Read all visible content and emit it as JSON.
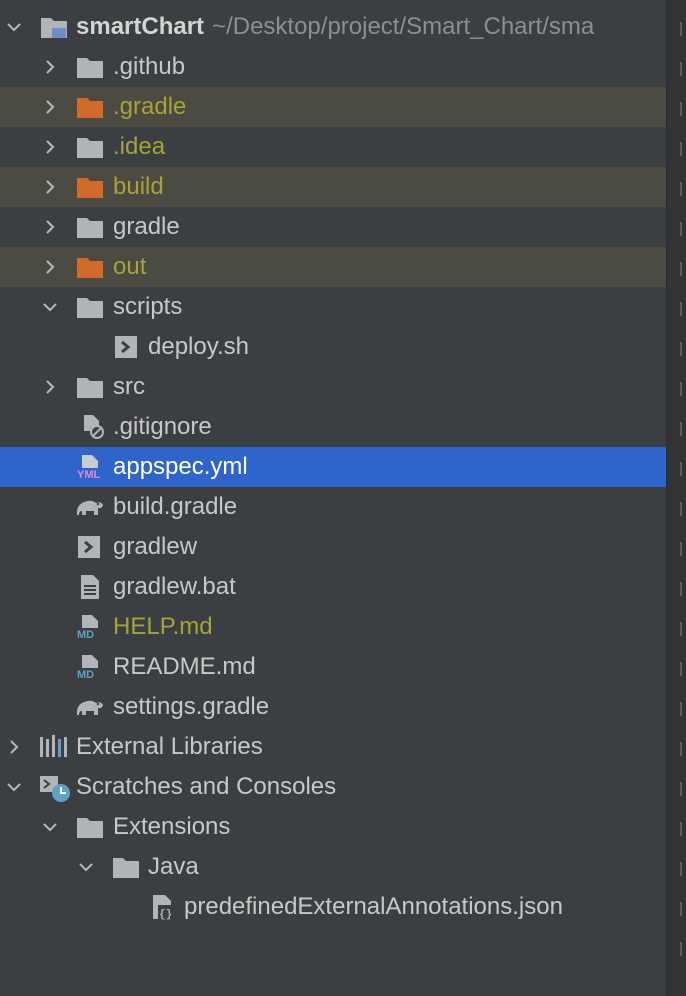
{
  "project": {
    "name": "smartChart",
    "path": "~/Desktop/project/Smart_Chart/sma"
  },
  "items": [
    {
      "label": ".github",
      "icon": "folder-icon"
    },
    {
      "label": ".gradle",
      "icon": "excluded-folder-icon",
      "status": "ignored"
    },
    {
      "label": ".idea",
      "icon": "folder-icon",
      "status": "ignored-text"
    },
    {
      "label": "build",
      "icon": "excluded-folder-icon",
      "status": "ignored"
    },
    {
      "label": "gradle",
      "icon": "folder-icon"
    },
    {
      "label": "out",
      "icon": "excluded-folder-icon",
      "status": "ignored"
    },
    {
      "label": "scripts",
      "icon": "folder-icon"
    },
    {
      "label": "deploy.sh",
      "icon": "shell-script-icon"
    },
    {
      "label": "src",
      "icon": "folder-icon"
    },
    {
      "label": ".gitignore",
      "icon": "gitignore-file-icon"
    },
    {
      "label": "appspec.yml",
      "icon": "yml-file-icon",
      "status": "selected"
    },
    {
      "label": "build.gradle",
      "icon": "gradle-elephant-icon"
    },
    {
      "label": "gradlew",
      "icon": "shell-script-icon"
    },
    {
      "label": "gradlew.bat",
      "icon": "text-file-icon"
    },
    {
      "label": "HELP.md",
      "icon": "markdown-file-icon",
      "status": "ignored-text"
    },
    {
      "label": "README.md",
      "icon": "markdown-file-icon"
    },
    {
      "label": "settings.gradle",
      "icon": "gradle-elephant-icon"
    },
    {
      "label": "External Libraries",
      "icon": "libraries-icon"
    },
    {
      "label": "Scratches and Consoles",
      "icon": "scratches-icon"
    },
    {
      "label": "Extensions",
      "icon": "folder-icon"
    },
    {
      "label": "Java",
      "icon": "folder-icon"
    },
    {
      "label": "predefinedExternalAnnotations.json",
      "icon": "json-file-icon"
    }
  ],
  "colors": {
    "background": "#3c3f41",
    "selection": "#2f65ca",
    "ignored_row": "#4c4b41",
    "ignored_text": "#a6a33a",
    "folder": "#b0b5ba",
    "excluded_folder": "#d06b2c"
  }
}
